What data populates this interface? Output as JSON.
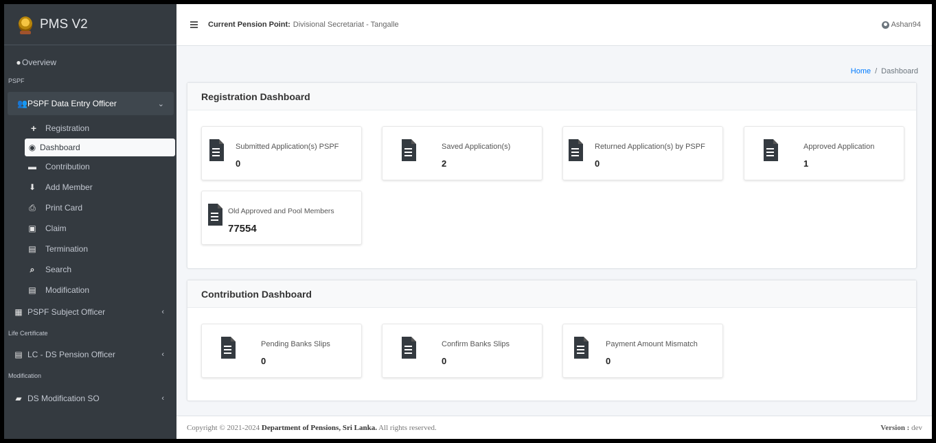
{
  "app": {
    "brand": "PMS V2"
  },
  "topbar": {
    "pension_point_label": "Current Pension Point:",
    "pension_point_value": "Divisional Secretariat - Tangalle",
    "user": "Ashan94"
  },
  "breadcrumb": {
    "home": "Home",
    "separator": "/",
    "current": "Dashboard"
  },
  "sidebar": {
    "overview": {
      "label": "Overview",
      "icon": "info-circle-icon"
    },
    "section_pspf": "PSPF",
    "data_entry_officer": {
      "label": "PSPF Data Entry Officer",
      "icon": "users-icon"
    },
    "items": [
      {
        "label": "Registration",
        "icon": "plus-icon"
      },
      {
        "label": "Dashboard",
        "icon": "dashboard-icon"
      },
      {
        "label": "Contribution",
        "icon": "money-icon"
      },
      {
        "label": "Add Member",
        "icon": "download-icon"
      },
      {
        "label": "Print Card",
        "icon": "print-icon"
      },
      {
        "label": "Claim",
        "icon": "id-card-icon"
      },
      {
        "label": "Termination",
        "icon": "document-icon"
      },
      {
        "label": "Search",
        "icon": "search-icon"
      },
      {
        "label": "Modification",
        "icon": "document-icon"
      }
    ],
    "subject_officer": {
      "label": "PSPF Subject Officer",
      "icon": "archive-icon"
    },
    "section_life_certificate": "Life Certificate",
    "lc_officer": {
      "label": "LC - DS Pension Officer",
      "icon": "document-icon"
    },
    "section_modification": "Modification",
    "ds_modification": {
      "label": "DS Modification SO",
      "icon": "folder-icon"
    }
  },
  "registration_dashboard": {
    "title": "Registration Dashboard",
    "boxes": [
      {
        "label": "Submitted Application(s) PSPF",
        "value": "0"
      },
      {
        "label": "Saved Application(s)",
        "value": "2"
      },
      {
        "label": "Returned Application(s) by PSPF",
        "value": "0"
      },
      {
        "label": "Approved Application",
        "value": "1"
      },
      {
        "label": "Old Approved and Pool Members",
        "value": "77554"
      }
    ]
  },
  "contribution_dashboard": {
    "title": "Contribution Dashboard",
    "boxes": [
      {
        "label": "Pending Banks Slips",
        "value": "0"
      },
      {
        "label": "Confirm Banks Slips",
        "value": "0"
      },
      {
        "label": "Payment Amount Mismatch",
        "value": "0"
      }
    ]
  },
  "footer": {
    "copyright": "Copyright © 2021-2024",
    "org": "Department of Pensions, Sri Lanka.",
    "rights": "All rights reserved.",
    "version_label": "Version :",
    "version_value": "dev"
  }
}
